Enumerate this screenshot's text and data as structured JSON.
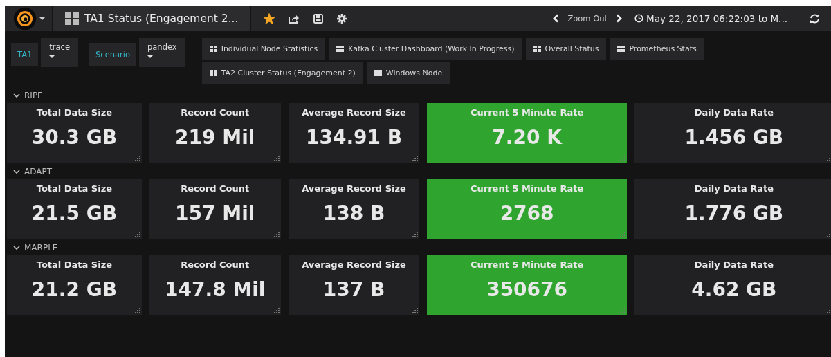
{
  "navbar": {
    "title": "TA1 Status (Engagement 2...",
    "starred": true,
    "zoom_label": "Zoom Out",
    "time_range": "May 22, 2017 06:22:03 to M..."
  },
  "variables": [
    {
      "label": "TA1",
      "value": "trace"
    },
    {
      "label": "Scenario",
      "value": "pandex"
    }
  ],
  "links": [
    "Individual Node Statistics",
    "Kafka Cluster Dashboard (Work In Progress)",
    "Overall Status",
    "Prometheus Stats",
    "TA2 Cluster Status (Engagement 2)",
    "Windows Node"
  ],
  "rows": [
    {
      "title": "RIPE",
      "expanded": true,
      "panels": [
        {
          "title": "Total Data Size",
          "value": "30.3 GB",
          "color": "#212124"
        },
        {
          "title": "Record Count",
          "value": "219 Mil",
          "color": "#212124"
        },
        {
          "title": "Average Record Size",
          "value": "134.91 B",
          "color": "#212124"
        },
        {
          "title": "Current 5 Minute Rate",
          "value": "7.20 K",
          "color": "#2fa52f"
        },
        {
          "title": "Daily Data Rate",
          "value": "1.456 GB",
          "color": "#212124"
        }
      ]
    },
    {
      "title": "ADAPT",
      "expanded": true,
      "panels": [
        {
          "title": "Total Data Size",
          "value": "21.5 GB",
          "color": "#212124"
        },
        {
          "title": "Record Count",
          "value": "157 Mil",
          "color": "#212124"
        },
        {
          "title": "Average Record Size",
          "value": "138 B",
          "color": "#212124"
        },
        {
          "title": "Current 5 Minute Rate",
          "value": "2768",
          "color": "#2fa52f"
        },
        {
          "title": "Daily Data Rate",
          "value": "1.776 GB",
          "color": "#212124"
        }
      ]
    },
    {
      "title": "MARPLE",
      "expanded": true,
      "panels": [
        {
          "title": "Total Data Size",
          "value": "21.2 GB",
          "color": "#212124"
        },
        {
          "title": "Record Count",
          "value": "147.8 Mil",
          "color": "#212124"
        },
        {
          "title": "Average Record Size",
          "value": "137 B",
          "color": "#212124"
        },
        {
          "title": "Current 5 Minute Rate",
          "value": "350676",
          "color": "#2fa52f"
        },
        {
          "title": "Daily Data Rate",
          "value": "4.62 GB",
          "color": "#212124"
        }
      ]
    }
  ]
}
